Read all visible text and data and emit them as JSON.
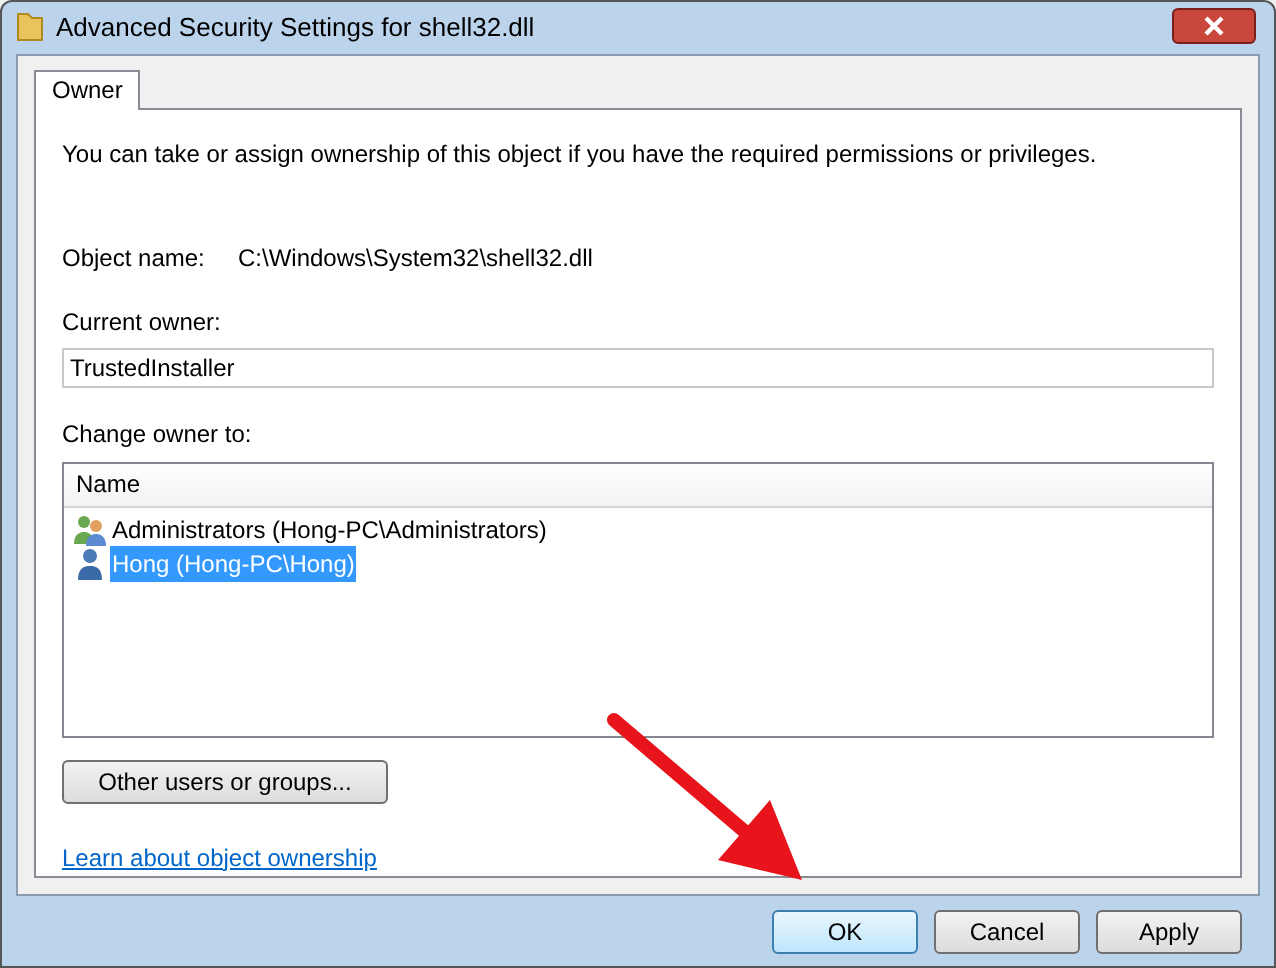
{
  "window": {
    "title": "Advanced Security Settings for shell32.dll"
  },
  "tabs": [
    {
      "label": "Owner",
      "selected": true
    }
  ],
  "intro": "You can take or assign ownership of this object if you have the required permissions or privileges.",
  "object_name": {
    "label": "Object name:",
    "value": "C:\\Windows\\System32\\shell32.dll"
  },
  "current_owner": {
    "label": "Current owner:",
    "value": "TrustedInstaller"
  },
  "change_owner": {
    "label": "Change owner to:",
    "columns": [
      "Name"
    ],
    "items": [
      {
        "name": "Administrators (Hong-PC\\Administrators)",
        "kind": "group",
        "selected": false
      },
      {
        "name": "Hong (Hong-PC\\Hong)",
        "kind": "user",
        "selected": true
      }
    ]
  },
  "other_button": "Other users or groups...",
  "link": "Learn about object ownership",
  "buttons": [
    {
      "label": "OK",
      "default": true
    },
    {
      "label": "Cancel",
      "default": false
    },
    {
      "label": "Apply",
      "default": false
    }
  ]
}
